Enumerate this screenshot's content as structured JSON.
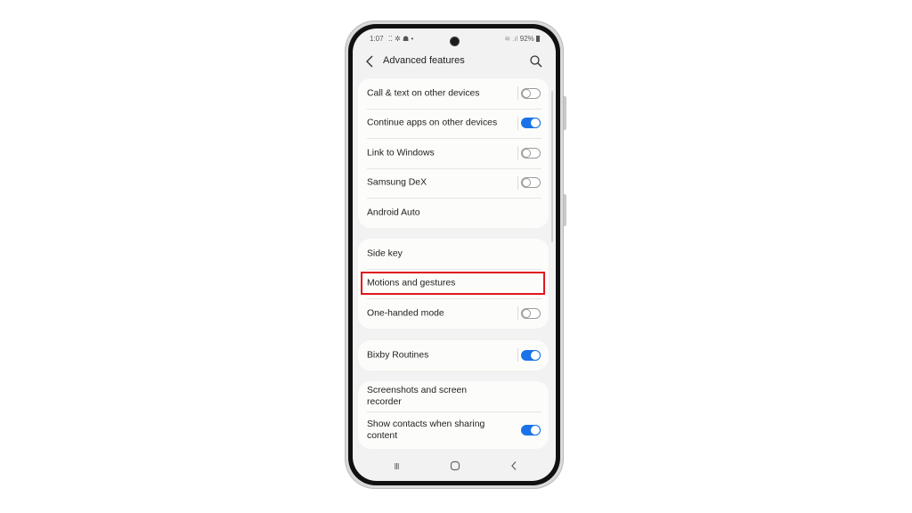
{
  "status_bar": {
    "time": "1:07",
    "notification_icons": "⁚⁚ ✲ ☗ •",
    "signal_icons": "≋ .ıl",
    "battery": "92%"
  },
  "header": {
    "title": "Advanced features",
    "back_icon": "chevron-left",
    "search_icon": "magnifier"
  },
  "groups": [
    {
      "items": [
        {
          "label": "Call & text on other devices",
          "toggle": "off"
        },
        {
          "label": "Continue apps on other devices",
          "toggle": "on"
        },
        {
          "label": "Link to Windows",
          "toggle": "off"
        },
        {
          "label": "Samsung DeX",
          "toggle": "off"
        },
        {
          "label": "Android Auto",
          "toggle": null
        }
      ]
    },
    {
      "items": [
        {
          "label": "Side key",
          "toggle": null
        },
        {
          "label": "Motions and gestures",
          "toggle": null,
          "highlighted": true
        },
        {
          "label": "One-handed mode",
          "toggle": "off"
        }
      ]
    },
    {
      "items": [
        {
          "label": "Bixby Routines",
          "toggle": "on"
        }
      ]
    },
    {
      "items": [
        {
          "label": "Screenshots and screen recorder",
          "toggle": null
        },
        {
          "label": "Show contacts when sharing content",
          "toggle": "on"
        }
      ]
    }
  ],
  "nav_bar": {
    "recents_glyph": "III",
    "home_glyph": "○",
    "back_glyph": "‹"
  },
  "colors": {
    "toggle_on": "#1a73e8",
    "highlight_box": "#e0161f"
  }
}
